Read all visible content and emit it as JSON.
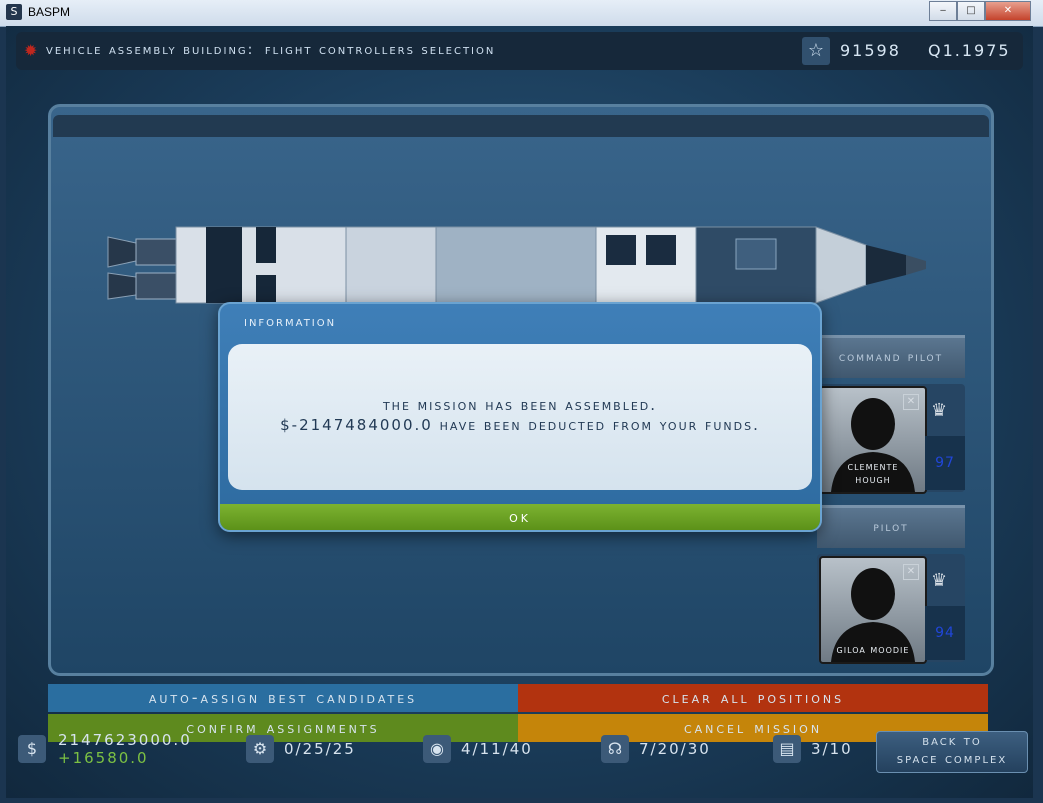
{
  "window": {
    "title": "BASPM",
    "icon_glyph": "S"
  },
  "header": {
    "location": "Vehicle Assembly Building:",
    "screen": "Flight Controllers Selection",
    "reputation": "91598",
    "date": "Q1.1975"
  },
  "crew": [
    {
      "role": "Command Pilot",
      "name_line1": "Clemente",
      "name_line2": "Hough",
      "skill": "97"
    },
    {
      "role": "Pilot",
      "name_line1": "Giloa Moodie",
      "name_line2": "",
      "skill": "94"
    }
  ],
  "actions": {
    "auto_assign": "Auto-Assign Best candidates",
    "clear_all": "Clear All Positions",
    "confirm": "Confirm Assignments",
    "cancel": "Cancel Mission"
  },
  "status": {
    "funds": "2147623000.0",
    "funds_delta": "+16580.0",
    "facilities": "0/25/25",
    "astronauts": "4/11/40",
    "controllers": "7/20/30",
    "missions": "3/10",
    "back_line1": "Back To",
    "back_line2": "Space Complex"
  },
  "dialog": {
    "title": "Information",
    "line1": "The mission has been assembled.",
    "line2": "$-2147484000.0 have been deducted from your funds.",
    "ok": "OK"
  },
  "colors": {
    "auto_assign": "#2a6ea0",
    "clear_all": "#b2330f",
    "confirm": "#5e8a1e",
    "cancel": "#c5850a",
    "ok": "#6aa125"
  }
}
